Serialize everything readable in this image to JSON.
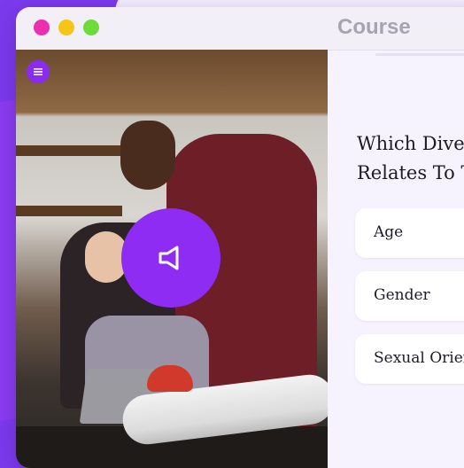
{
  "window": {
    "title": "Course",
    "controls": [
      "close",
      "minimize",
      "maximize"
    ]
  },
  "course": {
    "progress_segments": 4,
    "menu_icon": "menu-icon",
    "audio_icon": "speaker-icon"
  },
  "question": {
    "line1": "Which Dive",
    "line2": "Relates To T"
  },
  "options": [
    {
      "label": "Age"
    },
    {
      "label": "Gender"
    },
    {
      "label": "Sexual Orien"
    }
  ],
  "colors": {
    "accent": "#8e2cf4",
    "background": "#7c3aed",
    "dot_close": "#ec2fb0",
    "dot_minimize": "#f5c518",
    "dot_maximize": "#6ddc3a"
  }
}
